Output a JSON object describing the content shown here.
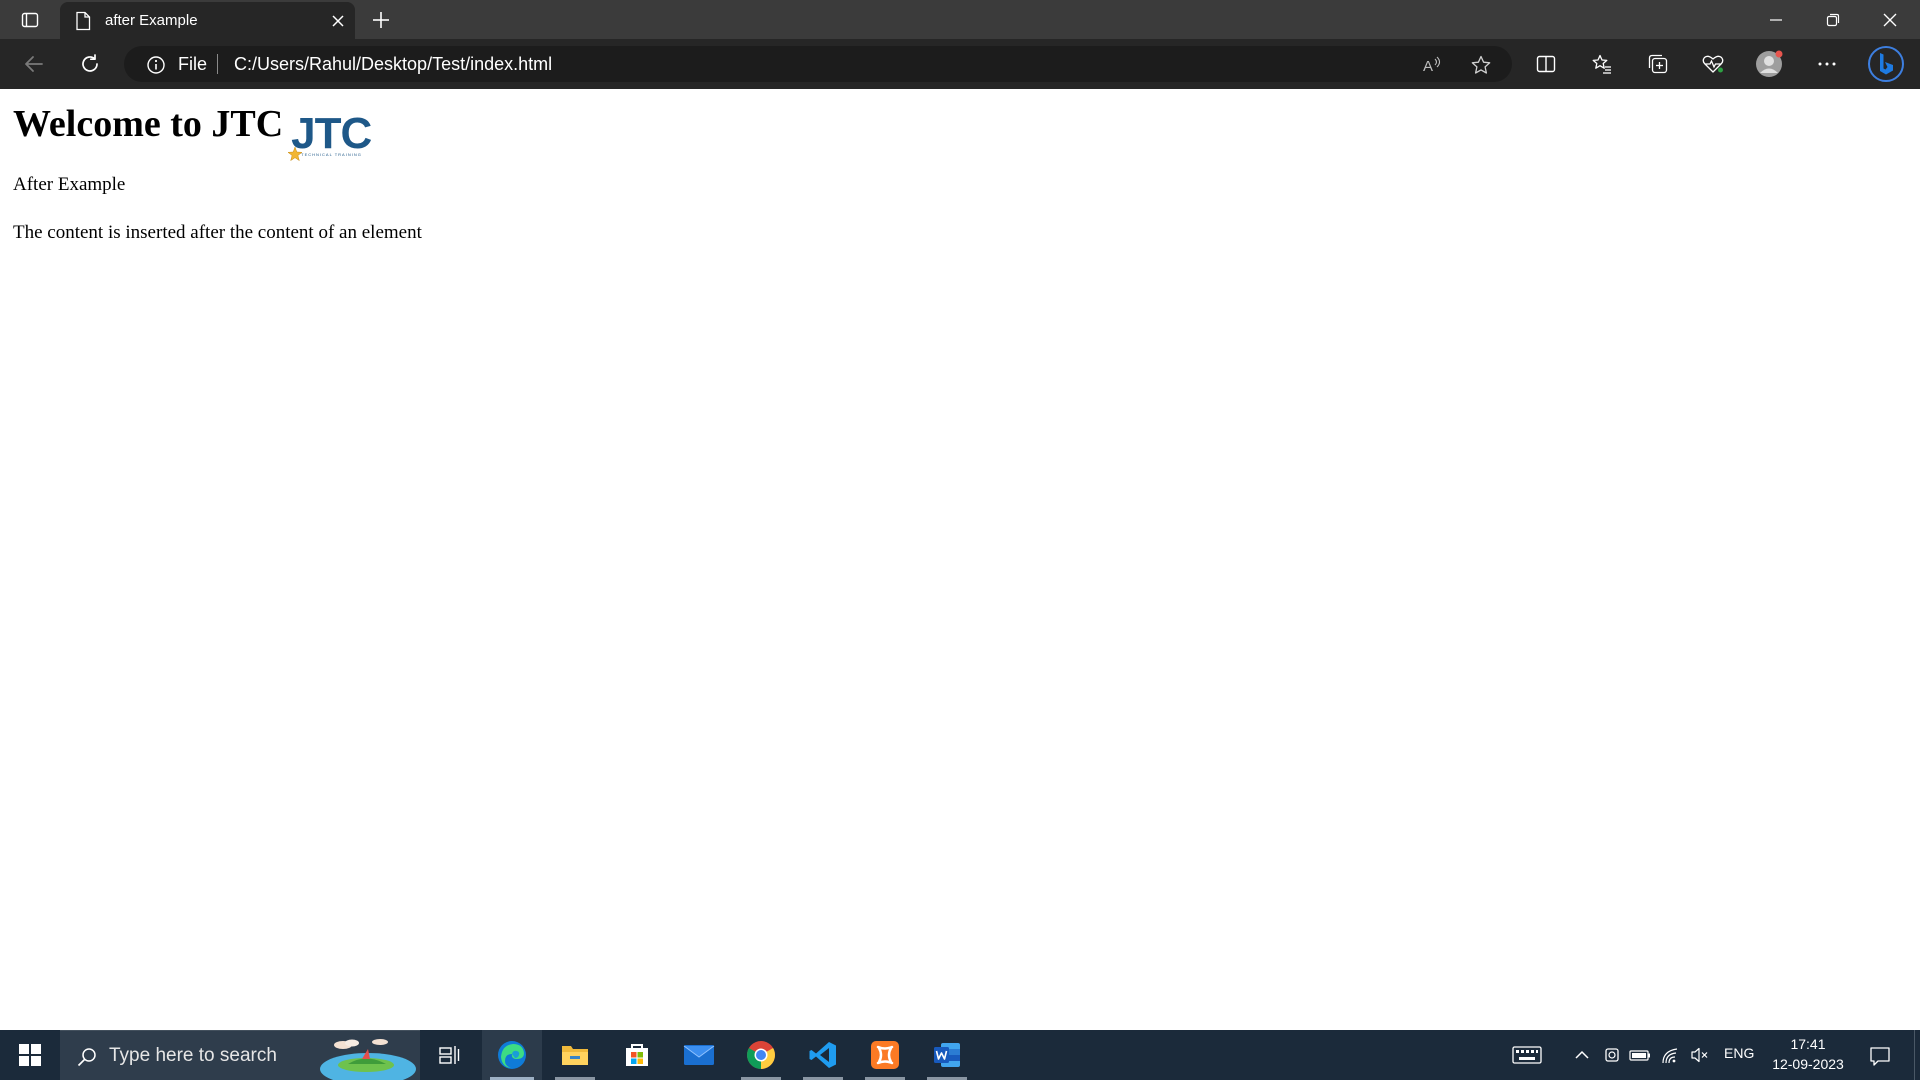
{
  "browser": {
    "tab": {
      "title": "after Example",
      "favicon": "file-icon",
      "close_icon": "close-icon"
    },
    "new_tab_icon": "plus-icon",
    "window_controls": [
      "minimize-icon",
      "restore-icon",
      "close-icon"
    ],
    "address": {
      "scheme_label": "File",
      "url": "C:/Users/Rahul/Desktop/Test/index.html"
    },
    "toolbar_icons": [
      "back-icon",
      "refresh-icon",
      "read-aloud-icon",
      "favorite-star-icon",
      "split-screen-icon",
      "favorites-icon",
      "collections-icon",
      "browser-essentials-icon",
      "profile-avatar",
      "more-icon",
      "bing-copilot-icon"
    ]
  },
  "page": {
    "heading": "Welcome to JTC",
    "logo": {
      "text": "JTC",
      "subtext": "TECHNICAL TRAINING"
    },
    "paragraph1": "After Example",
    "paragraph2": "The content is inserted after the content of an element"
  },
  "taskbar": {
    "search_placeholder": "Type here to search",
    "apps": [
      "task-view-icon",
      "edge-icon",
      "file-explorer-icon",
      "microsoft-store-icon",
      "mail-icon",
      "chrome-icon",
      "vscode-icon",
      "xampp-icon",
      "word-icon"
    ],
    "tray": {
      "language": "ENG",
      "time": "17:41",
      "date": "12-09-2023"
    },
    "colors": {
      "taskbar": "#1b2a3a",
      "accent_edge": "#0f7bd7"
    }
  }
}
